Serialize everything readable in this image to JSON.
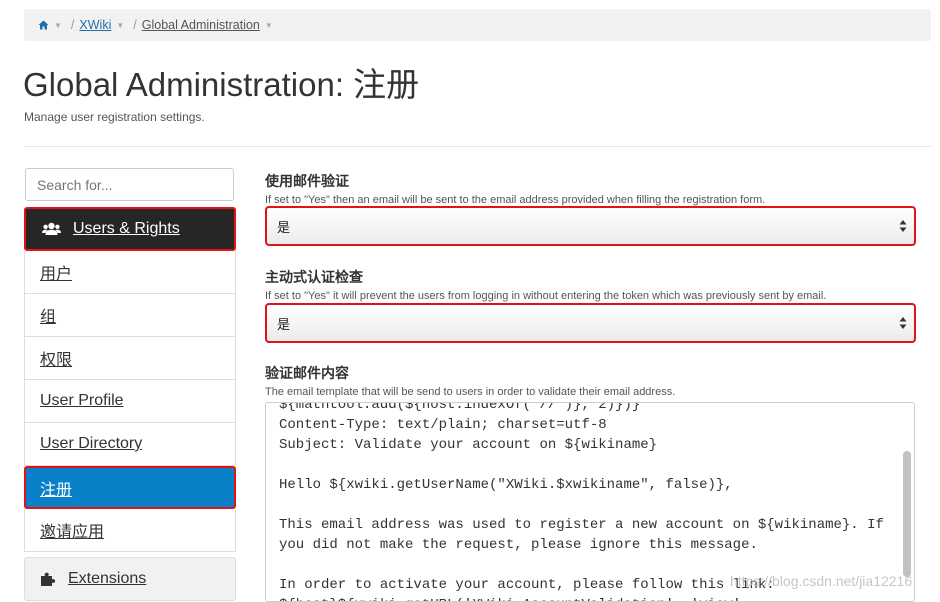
{
  "breadcrumb": {
    "items": [
      "XWiki",
      "Global Administration"
    ]
  },
  "page": {
    "title": "Global Administration: 注册",
    "subtitle": "Manage user registration settings."
  },
  "sidebar": {
    "search_placeholder": "Search for...",
    "section_title": "Users & Rights",
    "section_icon": "users-icon",
    "items": [
      "用户",
      "组",
      "权限",
      "User Profile",
      "User Directory",
      "注册",
      "邀请应用"
    ],
    "active_item": "注册",
    "extensions_label": "Extensions",
    "extensions_icon": "puzzle-icon"
  },
  "form": {
    "email_validation": {
      "label": "使用邮件验证",
      "hint": "If set to \"Yes\" then an email will be sent to the email address provided when filling the registration form.",
      "value": "是"
    },
    "active_check": {
      "label": "主动式认证检查",
      "hint": "If set to \"Yes\" it will prevent the users from logging in without entering the token which was previously sent by email.",
      "value": "是"
    },
    "email_content": {
      "label": "验证邮件内容",
      "hint": "The email template that will be send to users in order to validate their email address.",
      "value": "${mathtool.add(${host.indexOf('//')}, 2)})}\nContent-Type: text/plain; charset=utf-8\nSubject: Validate your account on ${wikiname}\n\nHello ${xwiki.getUserName(\"XWiki.$xwikiname\", false)},\n\nThis email address was used to register a new account on ${wikiname}. If\nyou did not make the request, please ignore this message.\n\nIn order to activate your account, please follow this link:\n${host}${xwiki.getURL('XWiki.AccountValidation', 'view',"
    }
  },
  "watermark": "https://blog.csdn.net/jia12216",
  "colors": {
    "active": "#0a80c9",
    "highlight_border": "#e01414",
    "dark_header": "#262626"
  }
}
